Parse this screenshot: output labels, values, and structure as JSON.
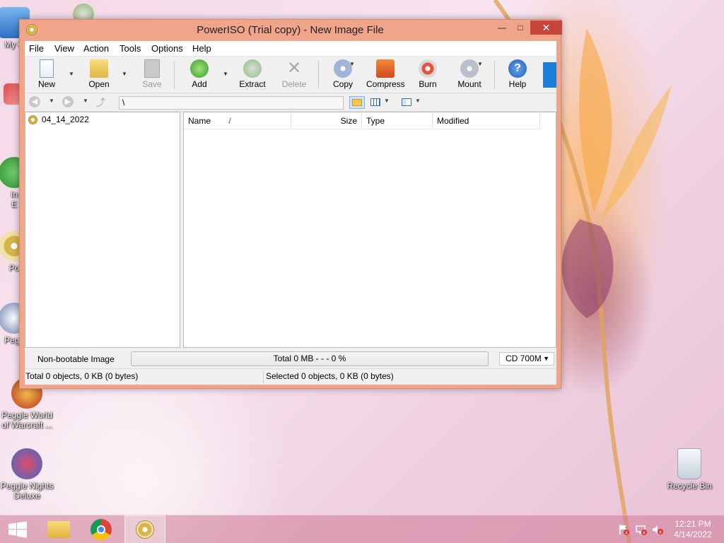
{
  "desktop": {
    "icons": [
      {
        "label": "My C"
      },
      {
        "label": "In\nE"
      },
      {
        "label": "Po"
      },
      {
        "label": "Pegg"
      },
      {
        "label": "Peggle World\nof Warcraft ..."
      },
      {
        "label": "Peggle Nights\nDeluxe"
      },
      {
        "label": "Recycle Bin"
      }
    ]
  },
  "window": {
    "title": "PowerISO (Trial copy) - New Image File",
    "controls": {
      "minimize": "—",
      "maximize": "□",
      "close": "✕"
    }
  },
  "menu": [
    "File",
    "View",
    "Action",
    "Tools",
    "Options",
    "Help"
  ],
  "toolbar": {
    "new": "New",
    "open": "Open",
    "save": "Save",
    "add": "Add",
    "extract": "Extract",
    "delete": "Delete",
    "copy": "Copy",
    "compress": "Compress",
    "burn": "Burn",
    "mount": "Mount",
    "help": "Help"
  },
  "address": {
    "path": "\\"
  },
  "tree": {
    "root": "04_14_2022"
  },
  "columns": {
    "name": "Name",
    "sort_indicator": "/",
    "size": "Size",
    "type": "Type",
    "modified": "Modified"
  },
  "status": {
    "boot": "Non-bootable Image",
    "progress": "Total  0 MB   - - -  0 %",
    "capacity": "CD 700M",
    "total": "Total 0 objects, 0 KB (0 bytes)",
    "selected": "Selected 0 objects, 0 KB (0 bytes)"
  },
  "taskbar": {
    "time": "12:21 PM",
    "date": "4/14/2022"
  },
  "colors": {
    "window_frame": "#f0a48a",
    "close_button": "#c7463b",
    "taskbar": "#cd7896"
  }
}
